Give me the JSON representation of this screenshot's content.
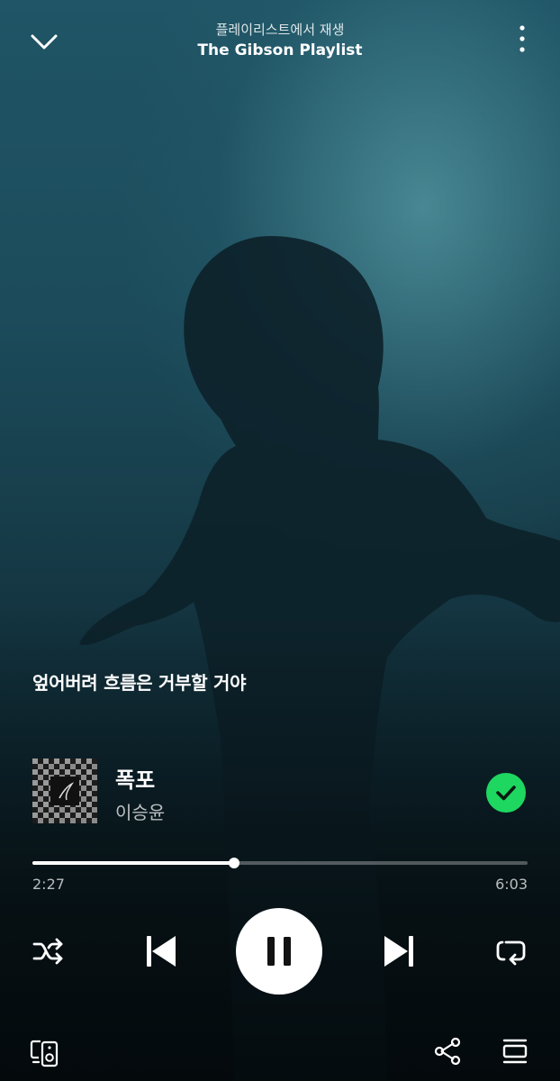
{
  "header": {
    "context_label": "플레이리스트에서 재생",
    "playlist_name": "The Gibson Playlist"
  },
  "lyrics": {
    "current_line": "엎어버려 흐름은 거부할 거야"
  },
  "track": {
    "title": "폭포",
    "artist": "이승윤",
    "saved": true,
    "cover_icon": "album-cover-checkered"
  },
  "playback": {
    "elapsed": "2:27",
    "duration": "6:03",
    "progress_fraction": 0.407,
    "state": "playing"
  },
  "controls": {
    "icons": [
      "chevron-down-icon",
      "more-vertical-icon",
      "check-icon",
      "shuffle-icon",
      "skip-previous-icon",
      "pause-icon",
      "skip-next-icon",
      "repeat-icon",
      "devices-icon",
      "share-icon",
      "queue-icon"
    ]
  },
  "colors": {
    "accent": "#1ed760",
    "background_top": "#1f5566",
    "background_bottom": "#081418"
  }
}
